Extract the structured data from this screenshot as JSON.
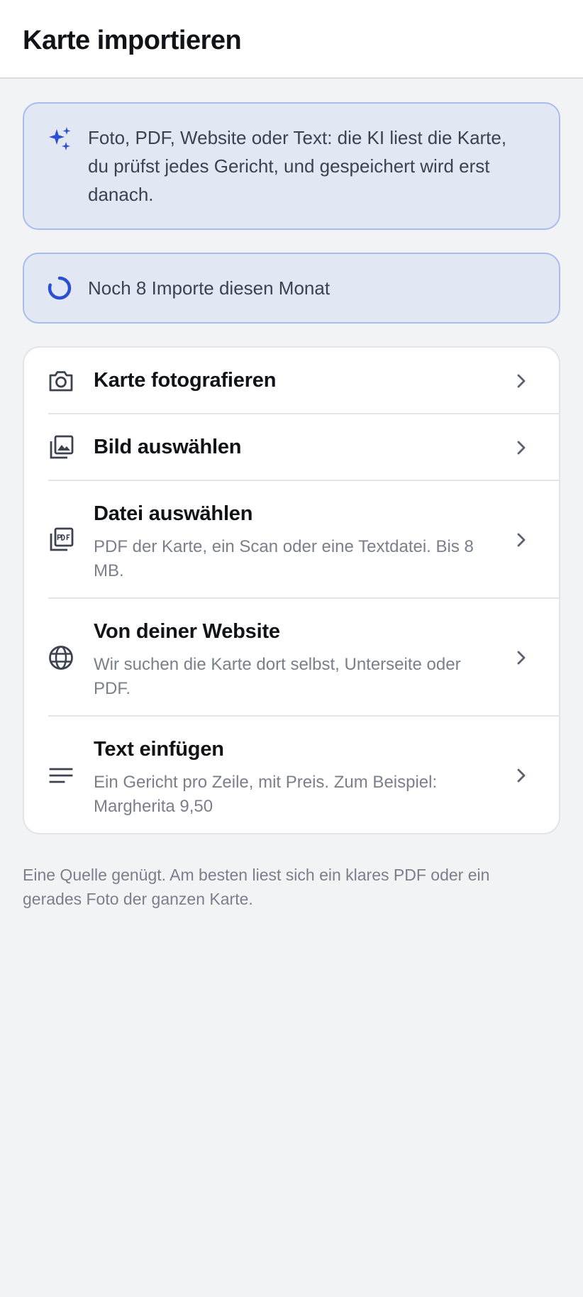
{
  "header": {
    "title": "Karte importieren"
  },
  "info": {
    "ai_text": "Foto, PDF, Website oder Text: die KI liest die Karte, du prüfst jedes Gericht, und gespeichert wird erst danach.",
    "quota_text": "Noch 8 Importe diesen Monat",
    "quota_fraction": 0.8
  },
  "options": [
    {
      "icon": "camera-icon",
      "title": "Karte fotografieren",
      "subtitle": ""
    },
    {
      "icon": "image-gallery-icon",
      "title": "Bild auswählen",
      "subtitle": ""
    },
    {
      "icon": "pdf-file-icon",
      "title": "Datei auswählen",
      "subtitle": "PDF der Karte, ein Scan oder eine Textdatei. Bis 8 MB."
    },
    {
      "icon": "globe-icon",
      "title": "Von deiner Website",
      "subtitle": "Wir suchen die Karte dort selbst, Unterseite oder PDF."
    },
    {
      "icon": "text-lines-icon",
      "title": "Text einfügen",
      "subtitle": "Ein Gericht pro Zeile, mit Preis. Zum Beispiel: Margherita 9,50"
    }
  ],
  "footer": {
    "note": "Eine Quelle genügt. Am besten liest sich ein klares PDF oder ein gerades Foto der ganzen Karte."
  },
  "colors": {
    "accent": "#2a4fd0",
    "info_bg": "#e2e7f4",
    "info_border": "#a9bcec",
    "icon": "#3d4250",
    "subtle_text": "#7a7f8b"
  }
}
